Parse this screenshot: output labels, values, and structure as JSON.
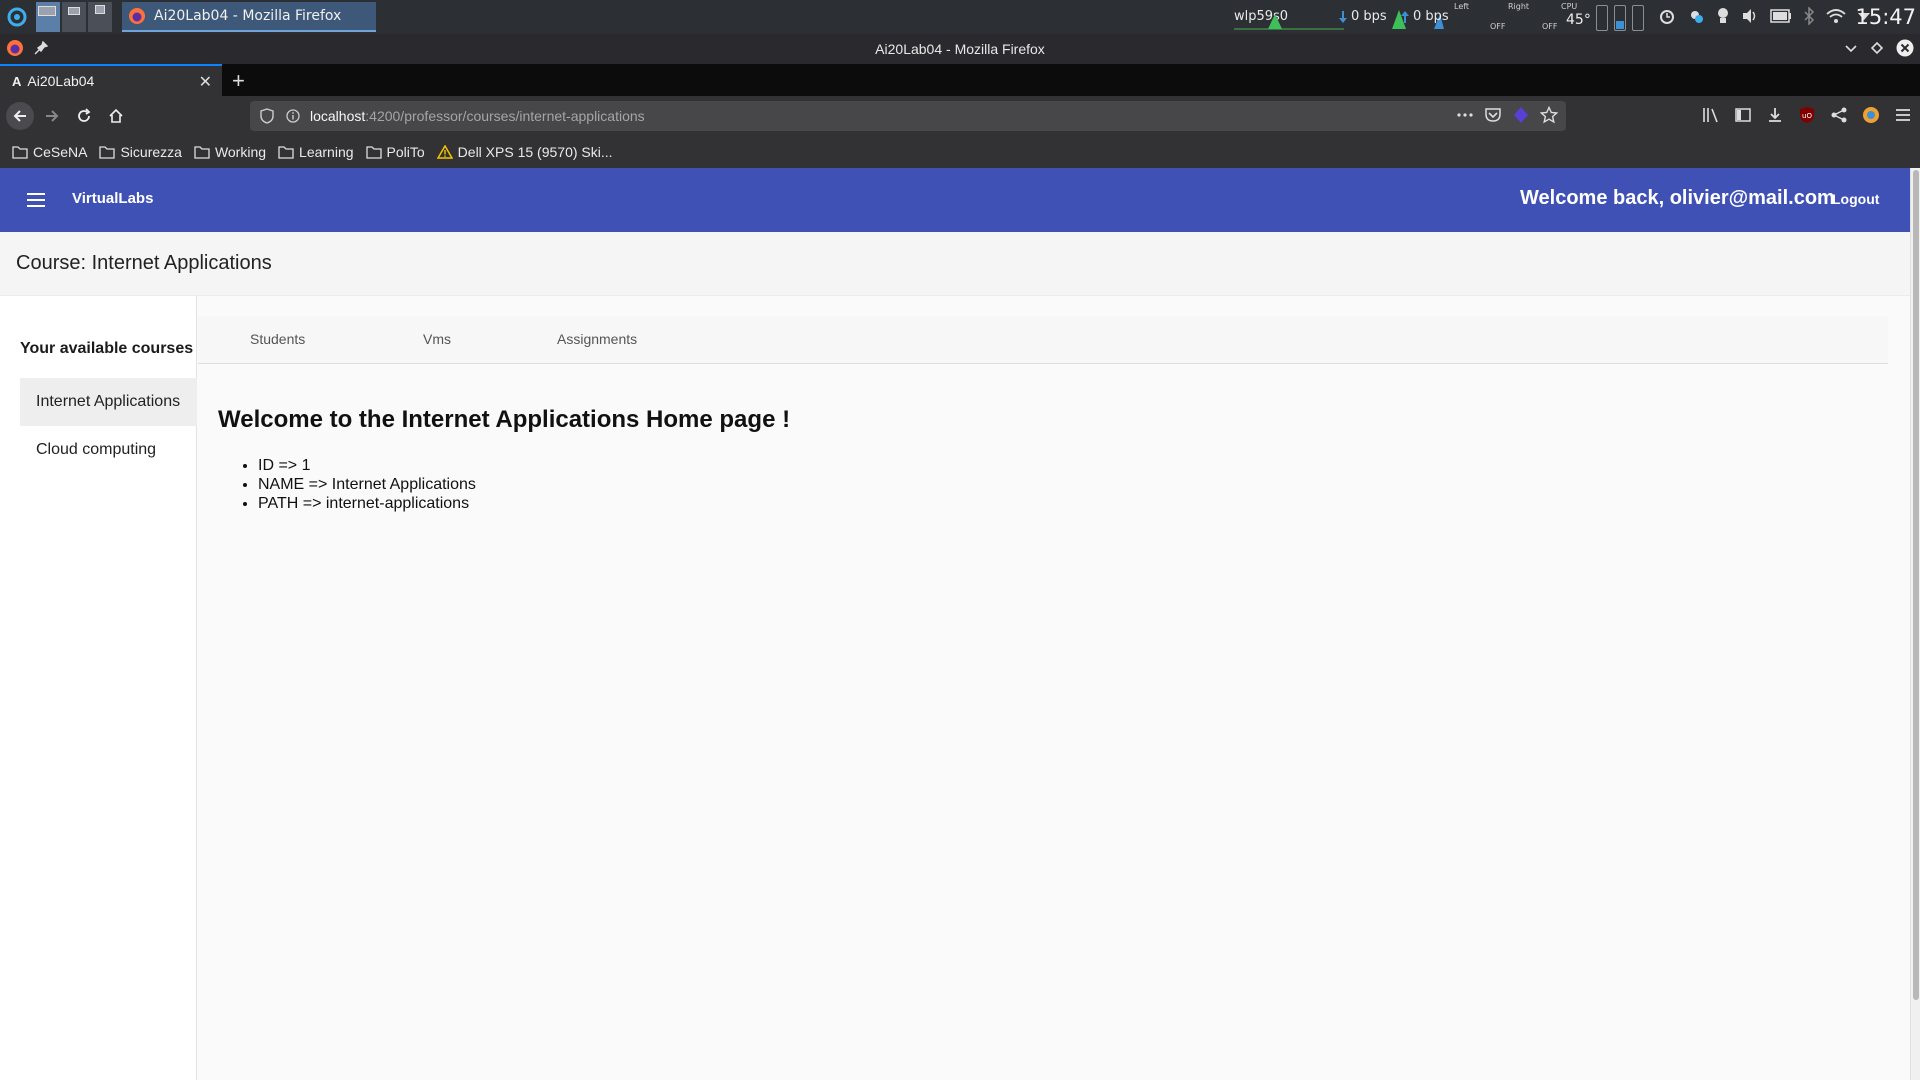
{
  "os_panel": {
    "task_title": "Ai20Lab04 - Mozilla Firefox",
    "net_iface": "wlp59s0",
    "down_rate": "0 bps",
    "up_rate": "0 bps",
    "label_left": "Left",
    "label_right": "Right",
    "label_off_1": "OFF",
    "label_off_2": "OFF",
    "cpu_label": "CPU",
    "cpu_temp": "45°",
    "clock": "15:47"
  },
  "browser": {
    "window_title": "Ai20Lab04 - Mozilla Firefox",
    "tab_title": "Ai20Lab04",
    "tab_favicon": "A",
    "url_host": "localhost",
    "url_path": ":4200/professor/courses/internet-applications",
    "bookmarks": [
      "CeSeNA",
      "Sicurezza",
      "Working",
      "Learning",
      "PoliTo",
      "Dell XPS 15 (9570) Ski..."
    ]
  },
  "app": {
    "brand": "VirtualLabs",
    "welcome": "Welcome back, olivier@mail.com",
    "logout": "Logout",
    "course_title": "Course: Internet Applications",
    "sidebar": {
      "heading": "Your available courses",
      "items": [
        "Internet Applications",
        "Cloud computing"
      ]
    },
    "tabs": [
      "Students",
      "Vms",
      "Assignments"
    ],
    "home_title": "Welcome to the Internet Applications Home page !",
    "details": [
      "ID => 1",
      "NAME => Internet Applications",
      "PATH => internet-applications"
    ]
  },
  "colors": {
    "toolbar": "#3f51b5",
    "firefox_accent": "#0a84ff"
  }
}
